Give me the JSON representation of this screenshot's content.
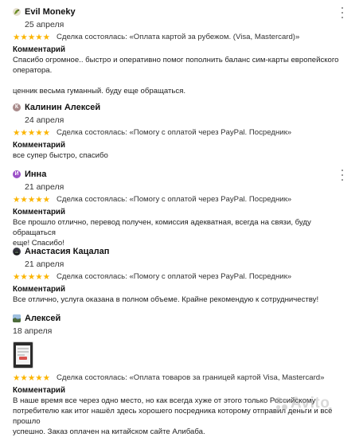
{
  "accent": {
    "star": "#fbb400"
  },
  "reviews": [
    {
      "name": "Evil Moneky",
      "avatar_icon": "gecko-avatar-icon",
      "date": "25 апреля",
      "stars": "★★★★★",
      "deal": "Сделка состоялась: «Оплата картой за рубежом. (Visa, Mastercard)»",
      "comment_title": "Комментарий",
      "comment": [
        "Спасибо огромное.. быстро и оперативно помог пополнить баланс сим-карты европейского",
        "оператора."
      ],
      "comment_extra": "ценник весьма гуманный. буду еще обращаться."
    },
    {
      "name": "Калинин Алексей",
      "avatar_letter": "К",
      "date": "24 апреля",
      "stars": "★★★★★",
      "deal": "Сделка состоялась: «Помогу с оплатой через PayPal. Посредник»",
      "comment_title": "Комментарий",
      "comment": [
        "все супер быстро, спасибо"
      ]
    },
    {
      "name": "Инна",
      "avatar_letter": "И",
      "date": "21 апреля",
      "stars": "★★★★★",
      "deal": "Сделка состоялась: «Помогу с оплатой через PayPal. Посредник»",
      "comment_title": "Комментарий",
      "comment": [
        "Все прошло отлично, перевод получен, комиссия адекватная, всегда на связи, буду обращаться",
        "еще! Спасибо!"
      ]
    },
    {
      "name": "Анастасия Кацалап",
      "avatar_icon": "cat-avatar-icon",
      "date": "21 апреля",
      "stars": "★★★★★",
      "deal": "Сделка состоялась: «Помогу с оплатой через PayPal. Посредник»",
      "comment_title": "Комментарий",
      "comment": [
        "Все отлично, услуга оказана в полном объеме. Крайне рекомендую к сотрудничеству!"
      ]
    },
    {
      "name": "Алексей",
      "avatar_icon": "landscape-avatar-icon",
      "date": "18 апреля",
      "stars": "★★★★★",
      "deal": "Сделка состоялась: «Оплата товаров за границей картой Visa, Mastercard»",
      "comment_title": "Комментарий",
      "comment": [
        "В наше время все через одно место, но как всегда хуже от этого только Российскому",
        "потребителю как итог нашёл здесь хорошего посредника которому отправил деньги и всё прошло",
        "успешно. Заказ оплачен на китайском сайте Алибаба."
      ]
    }
  ],
  "watermark": "Avito"
}
